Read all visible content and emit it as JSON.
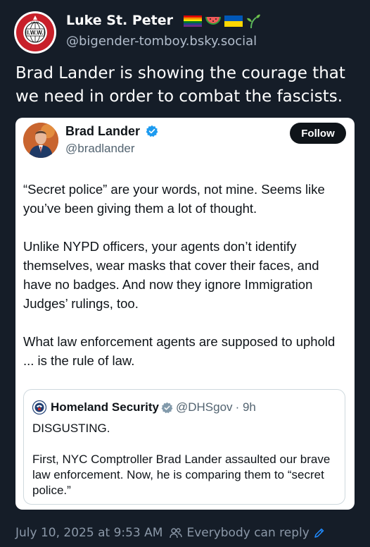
{
  "post": {
    "author_name": "Luke St. Peter",
    "author_handle": "@bigender-tomboy.bsky.social",
    "text": "Brad Lander is showing the courage that we need in order to combat the fascists.",
    "timestamp": "July 10, 2025 at 9:53 AM",
    "reply_setting": "Everybody can reply",
    "avatar_logo_text": "AN INJURY TO ONE IS AN INJURY TO ALL",
    "avatar_logo_mark": "I.W.W."
  },
  "embedded_tweet": {
    "author_name": "Brad Lander",
    "author_handle": "@bradlander",
    "follow_label": "Follow",
    "paragraphs": [
      "“Secret police” are your words, not mine. Seems like you’ve been giving them a lot of thought.",
      "Unlike NYPD officers, your agents don’t identify themselves, wear masks that cover their faces, and have no badges. And now they ignore Immigration Judges’ rulings, too.",
      "What law enforcement agents are supposed to uphold ... is the rule of law."
    ],
    "quoted": {
      "author_name": "Homeland Security",
      "author_handle": "@DHSgov",
      "time": "· 9h",
      "paragraphs": [
        "DISGUSTING.",
        "First, NYC Comptroller Brad Lander assaulted our brave law enforcement. Now, he is comparing them to “secret police.”"
      ]
    }
  },
  "colors": {
    "background": "#151d28",
    "card": "#ffffff",
    "verified_blue": "#1d9bf0",
    "verified_gray": "#829aab",
    "muted": "#8b98a8",
    "accent": "#208bfe"
  },
  "icons": {
    "flair": [
      "rainbow-flag-icon",
      "watermelon-icon",
      "ukraine-flag-icon",
      "seedling-icon"
    ],
    "verified": "verified-badge-icon",
    "reply": "people-icon",
    "edit": "pencil-icon"
  }
}
